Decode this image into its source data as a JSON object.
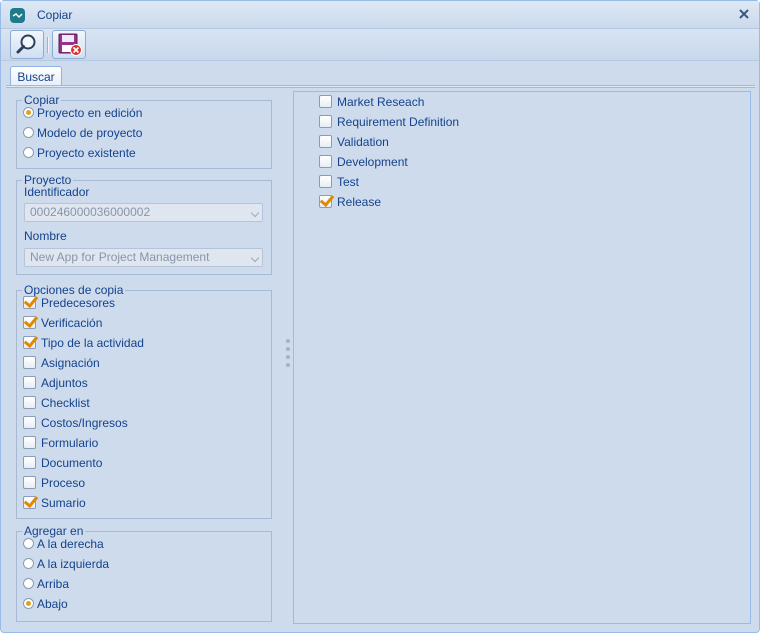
{
  "window": {
    "title": "Copiar"
  },
  "toolbar": {
    "search_icon": "magnifier-icon",
    "cancel_save_icon": "floppy-disk-cancel-icon"
  },
  "tabs": [
    {
      "label": "Buscar",
      "active": true
    }
  ],
  "copy_group": {
    "legend": "Copiar",
    "options": [
      {
        "label": "Proyecto en edición",
        "selected": true
      },
      {
        "label": "Modelo de proyecto",
        "selected": false
      },
      {
        "label": "Proyecto existente",
        "selected": false
      }
    ]
  },
  "project_group": {
    "legend": "Proyecto",
    "identifier_label": "Identificador",
    "identifier_value": "000246000036000002",
    "name_label": "Nombre",
    "name_value": "New App for Project Management"
  },
  "copy_options_group": {
    "legend": "Opciones de copia",
    "items": [
      {
        "label": "Predecesores",
        "checked": true
      },
      {
        "label": "Verificación",
        "checked": true
      },
      {
        "label": "Tipo de la actividad",
        "checked": true
      },
      {
        "label": "Asignación",
        "checked": false
      },
      {
        "label": "Adjuntos",
        "checked": false
      },
      {
        "label": "Checklist",
        "checked": false
      },
      {
        "label": "Costos/Ingresos",
        "checked": false
      },
      {
        "label": "Formulario",
        "checked": false
      },
      {
        "label": "Documento",
        "checked": false
      },
      {
        "label": "Proceso",
        "checked": false
      },
      {
        "label": "Sumario",
        "checked": true
      }
    ]
  },
  "add_in_group": {
    "legend": "Agregar en",
    "options": [
      {
        "label": "A la derecha",
        "selected": false
      },
      {
        "label": "A la izquierda",
        "selected": false
      },
      {
        "label": "Arriba",
        "selected": false
      },
      {
        "label": "Abajo",
        "selected": true
      }
    ]
  },
  "phases": [
    {
      "label": "Market Reseach",
      "checked": false
    },
    {
      "label": "Requirement Definition",
      "checked": false
    },
    {
      "label": "Validation",
      "checked": false
    },
    {
      "label": "Development",
      "checked": false
    },
    {
      "label": "Test",
      "checked": false
    },
    {
      "label": "Release",
      "checked": true
    }
  ],
  "colors": {
    "text": "#15428b",
    "background": "#cddbed",
    "border": "#99bbe8",
    "check_accent": "#e08a00"
  }
}
